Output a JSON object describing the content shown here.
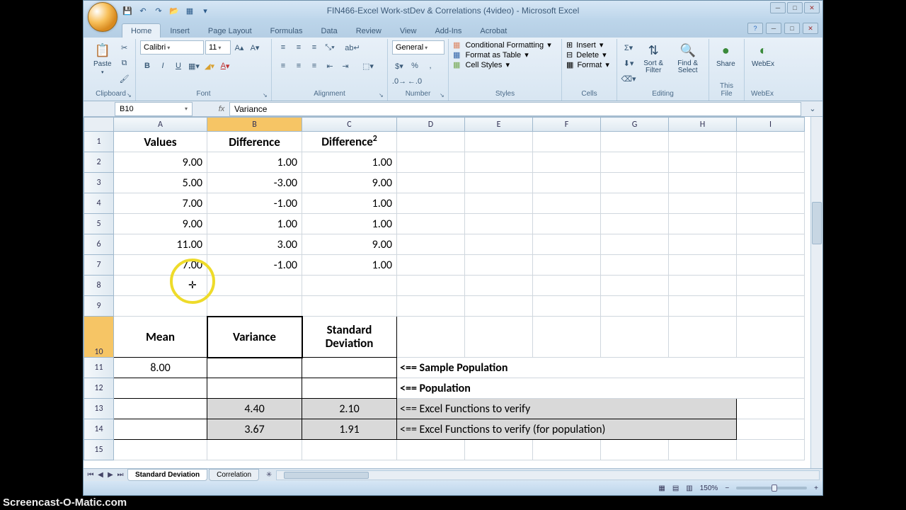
{
  "window": {
    "title": "FIN466-Excel Work-stDev & Correlations (4video) - Microsoft Excel"
  },
  "ribbon": {
    "tabs": [
      "Home",
      "Insert",
      "Page Layout",
      "Formulas",
      "Data",
      "Review",
      "View",
      "Add-Ins",
      "Acrobat"
    ],
    "active_tab": 0,
    "font_name": "Calibri",
    "font_size": "11",
    "number_format": "General",
    "groups": {
      "clipboard": {
        "paste": "Paste",
        "label": "Clipboard"
      },
      "font": {
        "label": "Font"
      },
      "alignment": {
        "label": "Alignment"
      },
      "number": {
        "label": "Number"
      },
      "styles": {
        "label": "Styles",
        "cond_fmt": "Conditional Formatting",
        "fmt_table": "Format as Table",
        "cell_styles": "Cell Styles"
      },
      "cells": {
        "label": "Cells",
        "insert": "Insert",
        "delete": "Delete",
        "format": "Format"
      },
      "editing": {
        "label": "Editing",
        "sort": "Sort & Filter",
        "find": "Find & Select"
      },
      "share": {
        "label": "This File",
        "btn": "Share"
      },
      "webex": {
        "label": "WebEx",
        "btn": "WebEx"
      }
    }
  },
  "formula_bar": {
    "name_box": "B10",
    "formula": "Variance"
  },
  "columns": [
    "A",
    "B",
    "C",
    "D",
    "E",
    "F",
    "G",
    "H",
    "I"
  ],
  "rows": [
    "1",
    "2",
    "3",
    "4",
    "5",
    "6",
    "7",
    "8",
    "9",
    "10",
    "11",
    "12",
    "13",
    "14",
    "15"
  ],
  "headers1": {
    "A": "Values",
    "B": "Difference",
    "C_html": "Difference<sup>2</sup>"
  },
  "data_rows": [
    {
      "A": "9.00",
      "B": "1.00",
      "C": "1.00"
    },
    {
      "A": "5.00",
      "B": "-3.00",
      "C": "9.00"
    },
    {
      "A": "7.00",
      "B": "-1.00",
      "C": "1.00"
    },
    {
      "A": "9.00",
      "B": "1.00",
      "C": "1.00"
    },
    {
      "A": "11.00",
      "B": "3.00",
      "C": "9.00"
    },
    {
      "A": "7.00",
      "B": "-1.00",
      "C": "1.00"
    }
  ],
  "headers10": {
    "A": "Mean",
    "B": "Variance",
    "C": "Standard Deviation"
  },
  "row11": {
    "A": "8.00",
    "D": "<== Sample Population"
  },
  "row12": {
    "D": "<== Population"
  },
  "row13": {
    "B": "4.40",
    "C": "2.10",
    "D": "<== Excel Functions to verify"
  },
  "row14": {
    "B": "3.67",
    "C": "1.91",
    "D": "<== Excel Functions to verify (for population)"
  },
  "sheet_tabs": {
    "active": "Standard Deviation",
    "other": "Correlation"
  },
  "status": {
    "zoom": "150%"
  },
  "watermark": "Screencast-O-Matic.com"
}
